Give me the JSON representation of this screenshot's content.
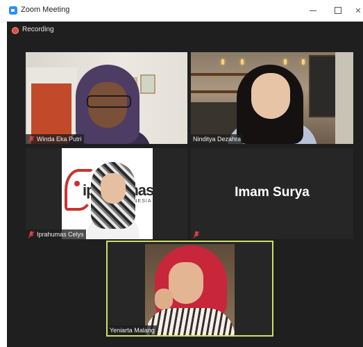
{
  "window": {
    "title": "Zoom Meeting",
    "minimize_icon": "minimize-icon",
    "maximize_icon": "maximize-icon",
    "close_icon": "close-icon"
  },
  "meeting": {
    "recording_label": "Recording",
    "active_speaker_color": "#cfe06a",
    "participants": [
      {
        "name": "Winda Eka Putri",
        "muted": true,
        "video": true
      },
      {
        "name": "Ninditya Dezahra",
        "muted": false,
        "video": true
      },
      {
        "name": "Iprahumas Celys",
        "muted": true,
        "video": true
      },
      {
        "name": "Imam Surya",
        "muted": true,
        "video": false
      },
      {
        "name": "Yeniarta Malang",
        "muted": false,
        "video": true,
        "active_speaker": true
      }
    ]
  },
  "logo": {
    "text": "iprahumas",
    "sub": "INDONESIA"
  }
}
